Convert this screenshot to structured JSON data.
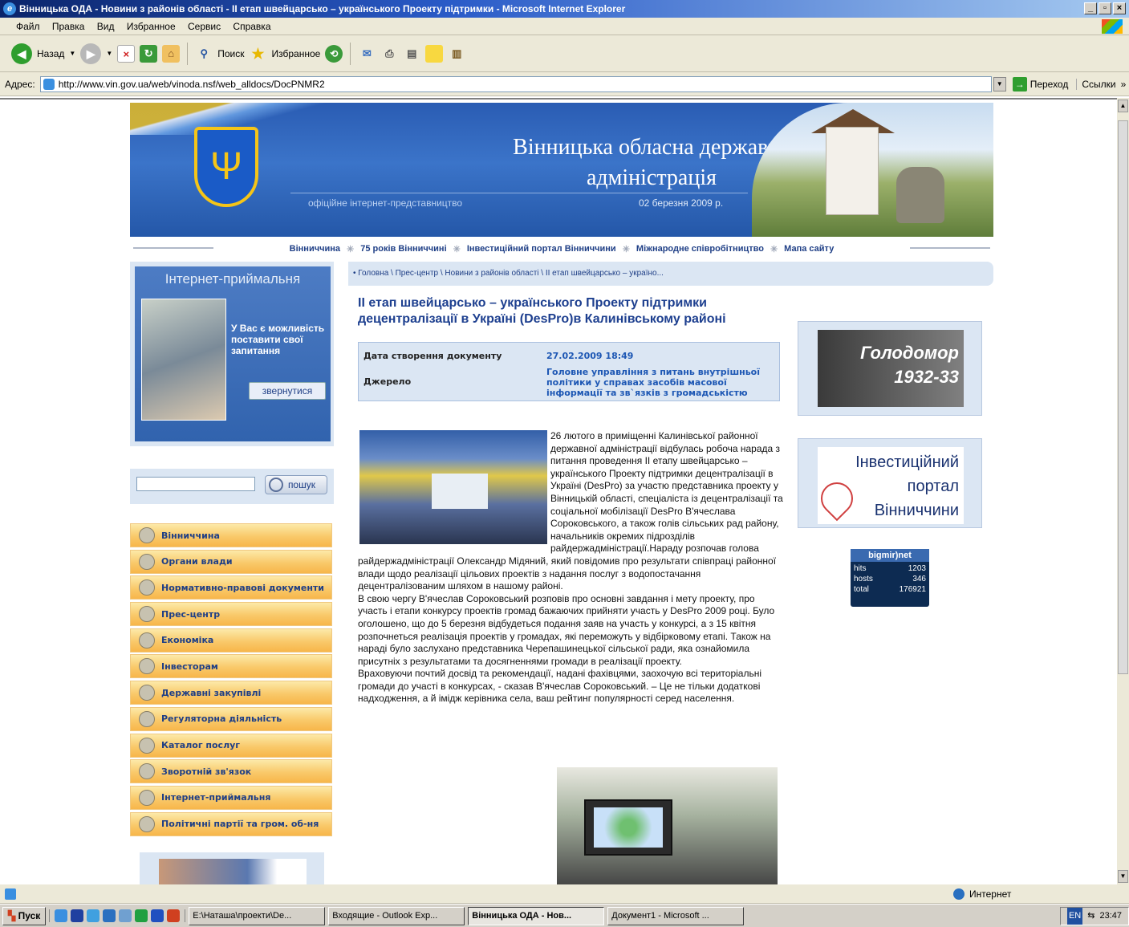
{
  "window": {
    "title": "Вінницька ОДА - Новини з районів області - ІІ етап швейцарсько – українського Проекту підтримки - Microsoft Internet Explorer"
  },
  "menu": [
    "Файл",
    "Правка",
    "Вид",
    "Избранное",
    "Сервис",
    "Справка"
  ],
  "toolbar": {
    "back": "Назад",
    "search": "Поиск",
    "favorites": "Избранное"
  },
  "address": {
    "label": "Адрес:",
    "url": "http://www.vin.gov.ua/web/vinoda.nsf/web_alldocs/DocPNMR2",
    "go": "Переход",
    "links": "Ссылки"
  },
  "header": {
    "title_line1": "Вінницька обласна державна",
    "title_line2": "адміністрація",
    "subtitle": "офіційне інтернет-представництво",
    "date": "02 березня 2009 р."
  },
  "topnav": [
    "Вінниччина",
    "75 років Вінниччині",
    "Інвестиційний портал Вінниччини",
    "Міжнародне співробітництво",
    "Мапа сайту"
  ],
  "reception": {
    "title": "Інтернет-приймальня",
    "text": "У Вас є можливість поставити свої запитання",
    "button": "звернутися"
  },
  "search": {
    "button": "пошук"
  },
  "sidebar_menu": [
    "Вінниччина",
    "Органи влади",
    "Нормативно-правові документи",
    "Прес-центр",
    "Економіка",
    "Інвесторам",
    "Державні закупівлі",
    "Регуляторна діяльність",
    "Каталог послуг",
    "Зворотній зв'язок",
    "Інтернет-приймальня",
    "Політичні партії та гром. об-ня"
  ],
  "breadcrumb": "• Головна \\ Прес-центр \\ Новини з районів області \\ ІІ етап швейцарсько – україно...",
  "article": {
    "title": "ІІ етап швейцарсько – українського Проекту підтримки децентралізації в Україні (DesPro)в Калинівському районі",
    "created_label": "Дата створення документу",
    "created_value": "27.02.2009   18:49",
    "source_label": "Джерело",
    "source_value": "Головне управління з питань внутрішньої політики у справах засобів масової інформації та зв`язків з громадськістю",
    "p1": "26 лютого в приміщенні Калинівської районної державної адміністрації відбулась робоча нарада з питання проведення ІІ етапу швейцарсько – українського Проекту підтримки децентралізації в Україні (DesPro) за участю представника проекту у Вінницькій області, спеціаліста із децентралізації та соціальної мобілізації DesPro В'ячеслава Сороковського, а також голів сільських рад району, начальників окремих підрозділів райдержадміністрації.Нараду розпочав голова райдержадміністрації Олександр Мідяний, який повідомив про результати співпраці районної влади щодо реалізації цільових проектів з надання послуг з водопостачання децентралізованим шляхом в нашому районі.",
    "p2": "В свою чергу В'ячеслав Сороковський розповів про основні завдання і мету проекту, про участь і етапи конкурсу проектів громад бажаючих прийняти участь у DesPro 2009 році. Було оголошено, що до 5 березня відбудеться подання заяв на участь у конкурсі, а з 15 квітня розпочнеться реалізація проектів у громадах, які переможуть у відбірковому етапі. Також на нараді було заслухано представника Черепашинецької сільської ради, яка ознайомила присутніх з результатами та досягненнями громади в реалізації проекту.",
    "p3": "Враховуючи почтий досвід та рекомендації, надані фахівцями, заохочую всі територіальні громади до участі в конкурсах, - сказав В'ячеслав Сороковський. – Це не тільки додаткові надходження, а й імідж керівника села, ваш рейтинг популярності серед населення."
  },
  "banners": {
    "holodomor_1": "Голодомор",
    "holodomor_2": "1932-33",
    "invest_1": "Інвестиційний",
    "invest_2": "портал",
    "invest_3": "Вінниччини"
  },
  "counter": {
    "brand": "bigmir)net",
    "hits_label": "hits",
    "hits": "1203",
    "hosts_label": "hosts",
    "hosts": "346",
    "total_label": "total",
    "total": "176921"
  },
  "status": {
    "zone": "Интернет"
  },
  "taskbar": {
    "start": "Пуск",
    "tasks": [
      "E:\\Наташа\\проекти\\De...",
      "Входящие - Outlook Exp...",
      "Вінницька ОДА - Нов...",
      "Документ1 - Microsoft ..."
    ],
    "lang": "EN",
    "time": "23:47"
  }
}
